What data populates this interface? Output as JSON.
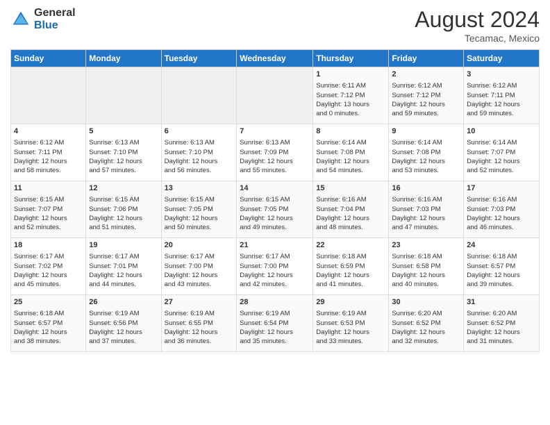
{
  "logo": {
    "general": "General",
    "blue": "Blue"
  },
  "title": "August 2024",
  "subtitle": "Tecamac, Mexico",
  "headers": [
    "Sunday",
    "Monday",
    "Tuesday",
    "Wednesday",
    "Thursday",
    "Friday",
    "Saturday"
  ],
  "weeks": [
    [
      {
        "day": "",
        "lines": []
      },
      {
        "day": "",
        "lines": []
      },
      {
        "day": "",
        "lines": []
      },
      {
        "day": "",
        "lines": []
      },
      {
        "day": "1",
        "lines": [
          "Sunrise: 6:11 AM",
          "Sunset: 7:12 PM",
          "Daylight: 13 hours",
          "and 0 minutes."
        ]
      },
      {
        "day": "2",
        "lines": [
          "Sunrise: 6:12 AM",
          "Sunset: 7:12 PM",
          "Daylight: 12 hours",
          "and 59 minutes."
        ]
      },
      {
        "day": "3",
        "lines": [
          "Sunrise: 6:12 AM",
          "Sunset: 7:11 PM",
          "Daylight: 12 hours",
          "and 59 minutes."
        ]
      }
    ],
    [
      {
        "day": "4",
        "lines": [
          "Sunrise: 6:12 AM",
          "Sunset: 7:11 PM",
          "Daylight: 12 hours",
          "and 58 minutes."
        ]
      },
      {
        "day": "5",
        "lines": [
          "Sunrise: 6:13 AM",
          "Sunset: 7:10 PM",
          "Daylight: 12 hours",
          "and 57 minutes."
        ]
      },
      {
        "day": "6",
        "lines": [
          "Sunrise: 6:13 AM",
          "Sunset: 7:10 PM",
          "Daylight: 12 hours",
          "and 56 minutes."
        ]
      },
      {
        "day": "7",
        "lines": [
          "Sunrise: 6:13 AM",
          "Sunset: 7:09 PM",
          "Daylight: 12 hours",
          "and 55 minutes."
        ]
      },
      {
        "day": "8",
        "lines": [
          "Sunrise: 6:14 AM",
          "Sunset: 7:08 PM",
          "Daylight: 12 hours",
          "and 54 minutes."
        ]
      },
      {
        "day": "9",
        "lines": [
          "Sunrise: 6:14 AM",
          "Sunset: 7:08 PM",
          "Daylight: 12 hours",
          "and 53 minutes."
        ]
      },
      {
        "day": "10",
        "lines": [
          "Sunrise: 6:14 AM",
          "Sunset: 7:07 PM",
          "Daylight: 12 hours",
          "and 52 minutes."
        ]
      }
    ],
    [
      {
        "day": "11",
        "lines": [
          "Sunrise: 6:15 AM",
          "Sunset: 7:07 PM",
          "Daylight: 12 hours",
          "and 52 minutes."
        ]
      },
      {
        "day": "12",
        "lines": [
          "Sunrise: 6:15 AM",
          "Sunset: 7:06 PM",
          "Daylight: 12 hours",
          "and 51 minutes."
        ]
      },
      {
        "day": "13",
        "lines": [
          "Sunrise: 6:15 AM",
          "Sunset: 7:05 PM",
          "Daylight: 12 hours",
          "and 50 minutes."
        ]
      },
      {
        "day": "14",
        "lines": [
          "Sunrise: 6:15 AM",
          "Sunset: 7:05 PM",
          "Daylight: 12 hours",
          "and 49 minutes."
        ]
      },
      {
        "day": "15",
        "lines": [
          "Sunrise: 6:16 AM",
          "Sunset: 7:04 PM",
          "Daylight: 12 hours",
          "and 48 minutes."
        ]
      },
      {
        "day": "16",
        "lines": [
          "Sunrise: 6:16 AM",
          "Sunset: 7:03 PM",
          "Daylight: 12 hours",
          "and 47 minutes."
        ]
      },
      {
        "day": "17",
        "lines": [
          "Sunrise: 6:16 AM",
          "Sunset: 7:03 PM",
          "Daylight: 12 hours",
          "and 46 minutes."
        ]
      }
    ],
    [
      {
        "day": "18",
        "lines": [
          "Sunrise: 6:17 AM",
          "Sunset: 7:02 PM",
          "Daylight: 12 hours",
          "and 45 minutes."
        ]
      },
      {
        "day": "19",
        "lines": [
          "Sunrise: 6:17 AM",
          "Sunset: 7:01 PM",
          "Daylight: 12 hours",
          "and 44 minutes."
        ]
      },
      {
        "day": "20",
        "lines": [
          "Sunrise: 6:17 AM",
          "Sunset: 7:00 PM",
          "Daylight: 12 hours",
          "and 43 minutes."
        ]
      },
      {
        "day": "21",
        "lines": [
          "Sunrise: 6:17 AM",
          "Sunset: 7:00 PM",
          "Daylight: 12 hours",
          "and 42 minutes."
        ]
      },
      {
        "day": "22",
        "lines": [
          "Sunrise: 6:18 AM",
          "Sunset: 6:59 PM",
          "Daylight: 12 hours",
          "and 41 minutes."
        ]
      },
      {
        "day": "23",
        "lines": [
          "Sunrise: 6:18 AM",
          "Sunset: 6:58 PM",
          "Daylight: 12 hours",
          "and 40 minutes."
        ]
      },
      {
        "day": "24",
        "lines": [
          "Sunrise: 6:18 AM",
          "Sunset: 6:57 PM",
          "Daylight: 12 hours",
          "and 39 minutes."
        ]
      }
    ],
    [
      {
        "day": "25",
        "lines": [
          "Sunrise: 6:18 AM",
          "Sunset: 6:57 PM",
          "Daylight: 12 hours",
          "and 38 minutes."
        ]
      },
      {
        "day": "26",
        "lines": [
          "Sunrise: 6:19 AM",
          "Sunset: 6:56 PM",
          "Daylight: 12 hours",
          "and 37 minutes."
        ]
      },
      {
        "day": "27",
        "lines": [
          "Sunrise: 6:19 AM",
          "Sunset: 6:55 PM",
          "Daylight: 12 hours",
          "and 36 minutes."
        ]
      },
      {
        "day": "28",
        "lines": [
          "Sunrise: 6:19 AM",
          "Sunset: 6:54 PM",
          "Daylight: 12 hours",
          "and 35 minutes."
        ]
      },
      {
        "day": "29",
        "lines": [
          "Sunrise: 6:19 AM",
          "Sunset: 6:53 PM",
          "Daylight: 12 hours",
          "and 33 minutes."
        ]
      },
      {
        "day": "30",
        "lines": [
          "Sunrise: 6:20 AM",
          "Sunset: 6:52 PM",
          "Daylight: 12 hours",
          "and 32 minutes."
        ]
      },
      {
        "day": "31",
        "lines": [
          "Sunrise: 6:20 AM",
          "Sunset: 6:52 PM",
          "Daylight: 12 hours",
          "and 31 minutes."
        ]
      }
    ]
  ]
}
